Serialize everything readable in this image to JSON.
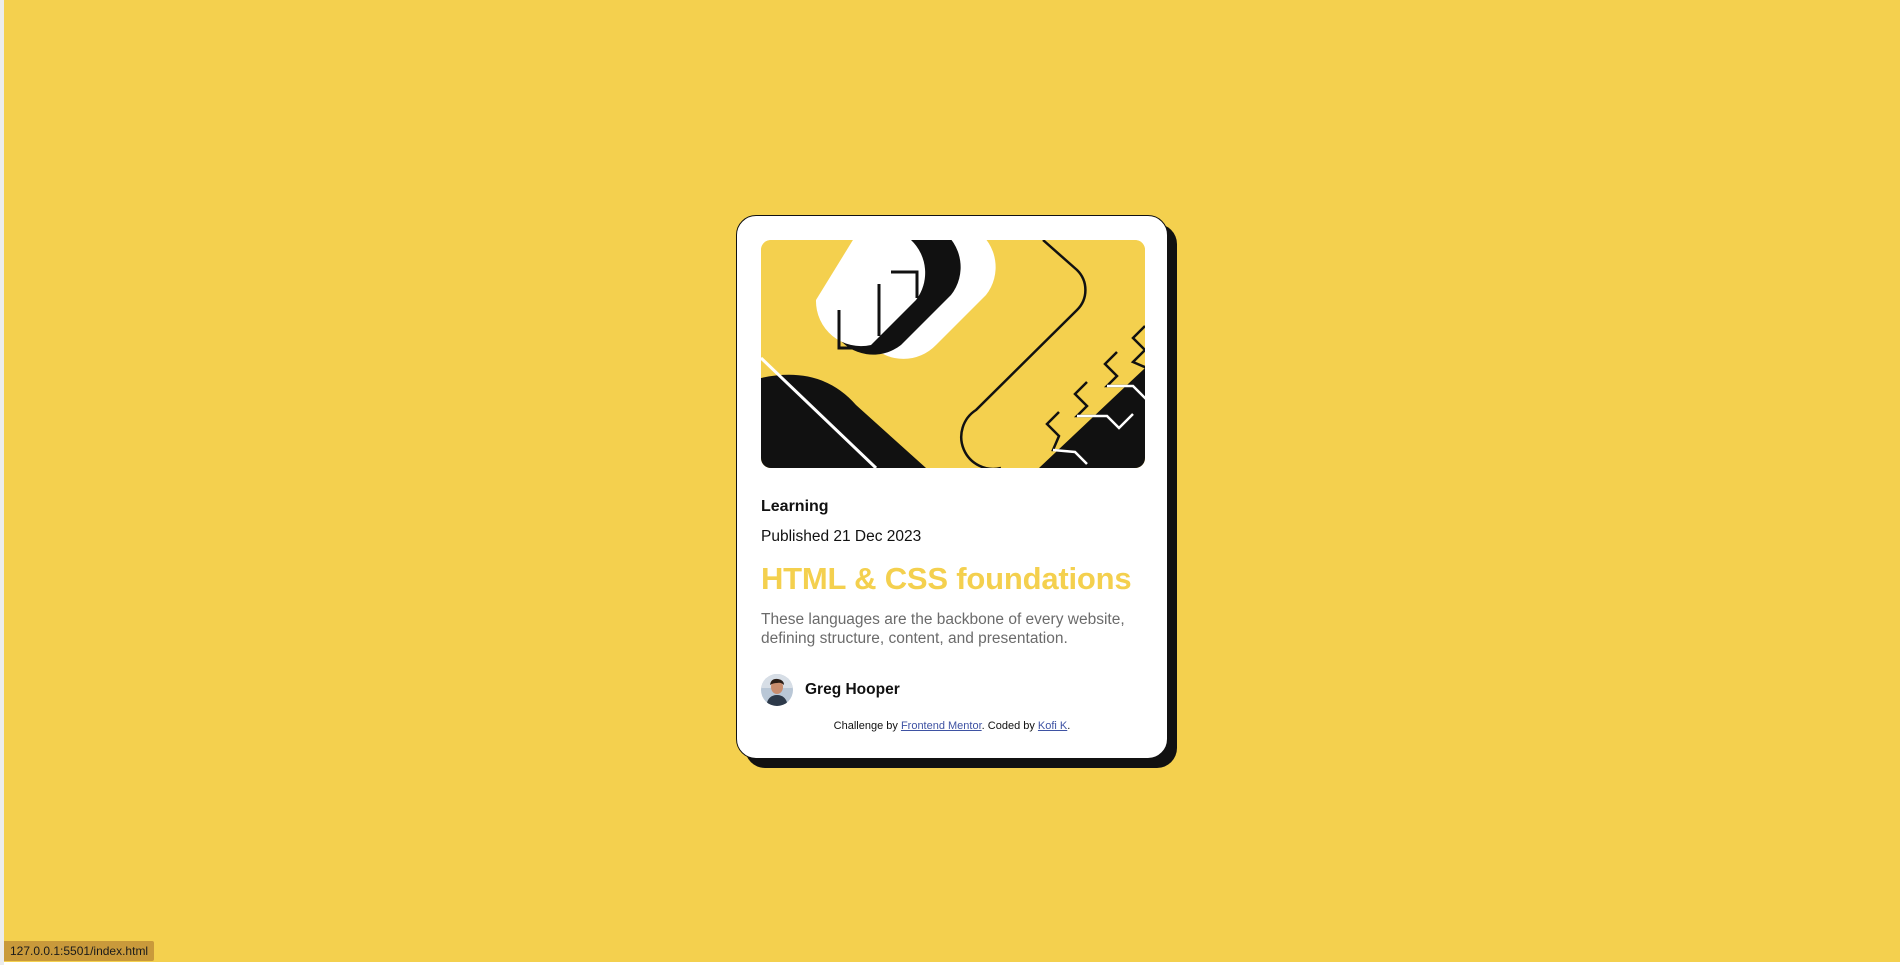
{
  "card": {
    "category": "Learning",
    "published": "Published 21 Dec 2023",
    "title": "HTML & CSS foundations",
    "description": "These languages are the backbone of every website, defining structure, content, and presentation."
  },
  "author": {
    "name": "Greg Hooper"
  },
  "attribution": {
    "prefix": "Challenge by",
    "link1": "Frontend Mentor",
    "middle": ". Coded by",
    "link2": "Kofi K",
    "suffix": "."
  },
  "status_bar": {
    "url": "127.0.0.1:5501/index.html"
  },
  "colors": {
    "background": "#f4d04e",
    "card": "#ffffff",
    "ink": "#111111",
    "title": "#f4d04e",
    "link": "#3e52a3"
  },
  "icons": {
    "illustration": "blog-illustration",
    "avatar": "author-avatar"
  }
}
